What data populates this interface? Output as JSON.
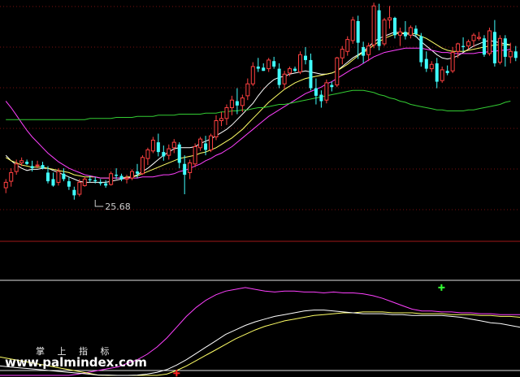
{
  "chart_data": [
    {
      "type": "candlestick",
      "title": "",
      "xlabel": "",
      "ylabel": "",
      "ylim": [
        22,
        44
      ],
      "up_color": "#ff4040",
      "down_color": "#40ffff",
      "annotations": [
        {
          "text": "25.68",
          "x": 17,
          "y": 25.68
        }
      ],
      "candles": [
        [
          26.8,
          27.6,
          26.3,
          27.3
        ],
        [
          27.4,
          28.6,
          26.9,
          28.2
        ],
        [
          28.3,
          29.4,
          28.0,
          29.0
        ],
        [
          29.1,
          29.6,
          28.8,
          29.3
        ],
        [
          29.2,
          29.4,
          28.9,
          29.0
        ],
        [
          28.8,
          29.3,
          28.3,
          28.6
        ],
        [
          28.9,
          29.3,
          28.6,
          28.9
        ],
        [
          28.9,
          29.2,
          28.5,
          28.6
        ],
        [
          28.2,
          28.8,
          27.2,
          27.4
        ],
        [
          27.6,
          28.2,
          26.9,
          27.0
        ],
        [
          27.3,
          28.6,
          27.0,
          28.3
        ],
        [
          28.1,
          28.6,
          27.4,
          27.6
        ],
        [
          27.4,
          27.8,
          26.6,
          26.9
        ],
        [
          26.6,
          26.9,
          25.7,
          26.1
        ],
        [
          26.2,
          27.6,
          26.0,
          27.3
        ],
        [
          27.0,
          27.8,
          26.9,
          27.6
        ],
        [
          27.6,
          27.9,
          27.3,
          27.5
        ],
        [
          27.5,
          27.8,
          27.2,
          27.4
        ],
        [
          27.3,
          27.6,
          27.0,
          27.2
        ],
        [
          27.2,
          27.5,
          26.8,
          27.0
        ],
        [
          27.1,
          28.3,
          27.0,
          28.1
        ],
        [
          28.0,
          28.6,
          27.6,
          27.9
        ],
        [
          27.9,
          28.1,
          27.4,
          27.6
        ],
        [
          27.6,
          28.0,
          27.2,
          27.7
        ],
        [
          27.7,
          28.5,
          27.5,
          28.3
        ],
        [
          28.3,
          29.0,
          27.7,
          28.1
        ],
        [
          28.1,
          29.8,
          28.0,
          29.6
        ],
        [
          29.5,
          30.5,
          28.9,
          30.3
        ],
        [
          30.2,
          31.5,
          30.0,
          31.2
        ],
        [
          31.0,
          31.8,
          29.7,
          30.1
        ],
        [
          30.1,
          30.7,
          29.3,
          29.7
        ],
        [
          29.8,
          30.8,
          29.4,
          30.4
        ],
        [
          30.5,
          31.3,
          30.0,
          31.0
        ],
        [
          30.8,
          31.0,
          28.6,
          29.1
        ],
        [
          29.0,
          29.8,
          26.2,
          28.0
        ],
        [
          28.2,
          29.4,
          27.6,
          29.1
        ],
        [
          29.0,
          30.9,
          28.7,
          30.6
        ],
        [
          30.5,
          31.5,
          30.2,
          31.3
        ],
        [
          30.9,
          31.6,
          29.8,
          30.3
        ],
        [
          30.3,
          31.8,
          30.1,
          31.6
        ],
        [
          31.5,
          33.5,
          31.2,
          33.0
        ],
        [
          33.0,
          33.8,
          32.5,
          33.2
        ],
        [
          33.2,
          34.5,
          32.6,
          34.2
        ],
        [
          34.2,
          35.3,
          33.5,
          34.9
        ],
        [
          34.8,
          36.0,
          33.6,
          34.4
        ],
        [
          34.4,
          35.4,
          33.8,
          35.1
        ],
        [
          35.3,
          36.9,
          34.9,
          36.4
        ],
        [
          36.4,
          38.4,
          36.2,
          38.0
        ],
        [
          38.0,
          38.8,
          37.5,
          37.8
        ],
        [
          37.9,
          38.3,
          37.6,
          37.6
        ],
        [
          37.8,
          38.8,
          37.5,
          38.6
        ],
        [
          38.5,
          38.9,
          37.8,
          38.0
        ],
        [
          37.8,
          38.3,
          36.0,
          36.3
        ],
        [
          36.4,
          37.6,
          35.9,
          37.3
        ],
        [
          37.4,
          38.0,
          37.1,
          37.8
        ],
        [
          37.8,
          38.0,
          37.5,
          37.6
        ],
        [
          37.5,
          39.4,
          37.3,
          39.1
        ],
        [
          39.0,
          39.8,
          38.2,
          38.6
        ],
        [
          38.6,
          39.2,
          35.8,
          36.0
        ],
        [
          36.0,
          36.9,
          34.5,
          35.3
        ],
        [
          35.4,
          35.8,
          34.2,
          34.8
        ],
        [
          34.9,
          36.8,
          34.6,
          36.5
        ],
        [
          36.3,
          36.6,
          35.7,
          36.1
        ],
        [
          36.3,
          38.9,
          36.1,
          38.8
        ],
        [
          38.8,
          39.9,
          38.2,
          39.6
        ],
        [
          39.4,
          40.8,
          39.0,
          40.5
        ],
        [
          40.4,
          42.6,
          40.1,
          42.3
        ],
        [
          42.2,
          42.7,
          38.7,
          40.2
        ],
        [
          39.8,
          40.3,
          38.3,
          39.0
        ],
        [
          39.1,
          40.2,
          38.5,
          39.9
        ],
        [
          40.0,
          43.9,
          39.7,
          43.6
        ],
        [
          43.2,
          43.8,
          39.5,
          39.9
        ],
        [
          40.1,
          42.5,
          39.9,
          42.3
        ],
        [
          42.3,
          43.6,
          41.5,
          42.5
        ],
        [
          42.5,
          42.6,
          40.6,
          40.9
        ],
        [
          40.9,
          41.6,
          39.9,
          41.2
        ],
        [
          41.2,
          42.2,
          40.5,
          40.8
        ],
        [
          40.9,
          41.8,
          40.6,
          41.6
        ],
        [
          41.5,
          41.8,
          40.7,
          41.0
        ],
        [
          40.8,
          41.1,
          38.0,
          38.4
        ],
        [
          38.7,
          39.4,
          37.5,
          37.8
        ],
        [
          37.8,
          38.5,
          37.5,
          38.2
        ],
        [
          38.3,
          38.8,
          36.0,
          36.6
        ],
        [
          36.7,
          38.0,
          36.5,
          37.7
        ],
        [
          37.6,
          38.1,
          37.2,
          37.4
        ],
        [
          37.6,
          39.8,
          37.4,
          39.3
        ],
        [
          39.4,
          40.2,
          38.8,
          40.1
        ],
        [
          39.9,
          40.7,
          39.4,
          39.8
        ],
        [
          39.9,
          40.5,
          39.6,
          40.3
        ],
        [
          40.4,
          41.1,
          39.8,
          40.9
        ],
        [
          40.6,
          41.2,
          40.4,
          40.7
        ],
        [
          40.6,
          40.9,
          38.9,
          39.1
        ],
        [
          39.2,
          41.6,
          39.0,
          41.3
        ],
        [
          41.2,
          42.3,
          38.0,
          38.3
        ],
        [
          38.4,
          40.9,
          38.2,
          40.6
        ],
        [
          40.6,
          40.9,
          38.0,
          38.9
        ],
        [
          38.9,
          40.2,
          38.3,
          39.4
        ],
        [
          39.4,
          39.9,
          38.5,
          38.8
        ]
      ],
      "series": [
        {
          "color": "#ffffff",
          "values": [
            29.8,
            29.3,
            28.9,
            28.6,
            28.4,
            28.5,
            28.5,
            28.6,
            28.6,
            28.4,
            28.2,
            28.0,
            27.8,
            27.6,
            27.4,
            27.3,
            27.3,
            27.3,
            27.3,
            27.3,
            27.4,
            27.5,
            27.6,
            27.7,
            27.8,
            28.0,
            28.3,
            28.6,
            29.0,
            29.4,
            29.8,
            30.1,
            30.4,
            30.5,
            30.5,
            30.5,
            30.6,
            30.9,
            31.1,
            31.3,
            31.6,
            31.9,
            32.2,
            32.6,
            33.1,
            33.6,
            34.1,
            34.6,
            35.3,
            35.9,
            36.4,
            36.8,
            37.0,
            37.1,
            37.3,
            37.4,
            37.5,
            37.6,
            37.5,
            37.4,
            37.3,
            37.3,
            37.4,
            37.6,
            38.0,
            38.4,
            38.8,
            39.1,
            39.4,
            39.8,
            40.3,
            40.6,
            40.8,
            41.0,
            41.2,
            41.1,
            41.0,
            41.0,
            40.8,
            40.3,
            39.9,
            39.5,
            39.1,
            38.8,
            38.7,
            38.8,
            39.0,
            39.3,
            39.6,
            39.9,
            40.1,
            40.3,
            40.4,
            40.3,
            40.2,
            40.1,
            40.0
          ]
        },
        {
          "color": "#ffff66",
          "values": [
            29.6,
            29.3,
            29.1,
            28.9,
            28.8,
            28.7,
            28.7,
            28.7,
            28.6,
            28.5,
            28.4,
            28.3,
            28.2,
            28.0,
            27.9,
            27.8,
            27.8,
            27.8,
            27.7,
            27.7,
            27.7,
            27.7,
            27.7,
            27.8,
            27.8,
            27.9,
            28.1,
            28.3,
            28.5,
            28.7,
            28.9,
            29.1,
            29.3,
            29.5,
            29.6,
            29.7,
            29.8,
            30.0,
            30.1,
            30.3,
            30.5,
            30.8,
            31.1,
            31.4,
            31.8,
            32.2,
            32.7,
            33.2,
            33.7,
            34.2,
            34.7,
            35.1,
            35.5,
            35.9,
            36.2,
            36.5,
            36.7,
            36.9,
            37.0,
            37.1,
            37.2,
            37.3,
            37.4,
            37.6,
            37.9,
            38.2,
            38.6,
            39.0,
            39.3,
            39.6,
            40.0,
            40.3,
            40.6,
            40.8,
            41.0,
            41.1,
            41.1,
            41.1,
            41.0,
            40.8,
            40.6,
            40.3,
            40.0,
            39.7,
            39.5,
            39.4,
            39.4,
            39.4,
            39.5,
            39.6,
            39.7,
            39.8,
            39.9,
            40.0,
            40.0,
            40.0,
            40.0
          ]
        },
        {
          "color": "#ff40ff",
          "values": [
            34.8,
            34.2,
            33.5,
            32.8,
            32.1,
            31.5,
            31.0,
            30.5,
            30.0,
            29.6,
            29.2,
            28.9,
            28.6,
            28.4,
            28.2,
            28.0,
            27.9,
            27.8,
            27.7,
            27.7,
            27.7,
            27.7,
            27.7,
            27.7,
            27.7,
            27.7,
            27.8,
            27.8,
            27.8,
            27.9,
            28.0,
            28.0,
            28.1,
            28.3,
            28.4,
            28.6,
            28.8,
            29.0,
            29.3,
            29.5,
            29.8,
            30.0,
            30.3,
            30.6,
            31.0,
            31.4,
            31.8,
            32.2,
            32.6,
            33.0,
            33.4,
            33.7,
            34.0,
            34.3,
            34.6,
            34.9,
            35.2,
            35.5,
            35.7,
            35.9,
            36.1,
            36.4,
            36.6,
            36.9,
            37.2,
            37.5,
            37.8,
            38.0,
            38.3,
            38.6,
            38.9,
            39.1,
            39.3,
            39.4,
            39.5,
            39.6,
            39.7,
            39.7,
            39.7,
            39.7,
            39.6,
            39.5,
            39.4,
            39.3,
            39.3,
            39.2,
            39.2,
            39.2,
            39.2,
            39.2,
            39.3,
            39.3,
            39.4,
            39.4,
            39.5,
            39.5,
            39.6
          ]
        },
        {
          "color": "#33cc33",
          "values": [
            33.1,
            33.1,
            33.1,
            33.1,
            33.1,
            33.1,
            33.1,
            33.1,
            33.1,
            33.1,
            33.1,
            33.1,
            33.1,
            33.1,
            33.1,
            33.1,
            33.2,
            33.2,
            33.2,
            33.2,
            33.2,
            33.3,
            33.3,
            33.3,
            33.3,
            33.4,
            33.4,
            33.4,
            33.4,
            33.5,
            33.5,
            33.5,
            33.5,
            33.6,
            33.6,
            33.6,
            33.6,
            33.6,
            33.7,
            33.7,
            33.7,
            33.8,
            33.8,
            33.9,
            33.9,
            34.0,
            34.0,
            34.1,
            34.2,
            34.2,
            34.3,
            34.4,
            34.5,
            34.5,
            34.6,
            34.7,
            34.8,
            34.9,
            35.0,
            35.1,
            35.2,
            35.3,
            35.4,
            35.5,
            35.6,
            35.7,
            35.8,
            35.8,
            35.8,
            35.7,
            35.6,
            35.4,
            35.3,
            35.1,
            35.0,
            34.8,
            34.7,
            34.5,
            34.4,
            34.3,
            34.2,
            34.1,
            34.0,
            34.0,
            33.9,
            33.9,
            33.9,
            33.9,
            34.0,
            34.0,
            34.1,
            34.2,
            34.3,
            34.4,
            34.5,
            34.7,
            34.8
          ]
        }
      ]
    },
    {
      "type": "line",
      "title": "",
      "xlabel": "",
      "ylabel": "",
      "ylim": [
        0,
        100
      ],
      "reference_lines": [
        90,
        0
      ],
      "markers": [
        {
          "x": 45,
          "y": 92,
          "color": "#33ff33"
        },
        {
          "x": 18,
          "y": -3,
          "color": "#ff2222"
        }
      ],
      "series": [
        {
          "color": "#ff40ff",
          "values": [
            -20,
            -18,
            -16,
            -14,
            -12,
            -10,
            -8,
            -6,
            -4,
            -2,
            0,
            2,
            4,
            8,
            12,
            18,
            26,
            36,
            48,
            60,
            70,
            78,
            84,
            88,
            90,
            92,
            90,
            88,
            87,
            88,
            88,
            87,
            87,
            86,
            87,
            86,
            86,
            85,
            83,
            80,
            76,
            72,
            68,
            66,
            66,
            65,
            65,
            64,
            64,
            63,
            63,
            62,
            62,
            62
          ]
        },
        {
          "color": "#ffff66",
          "values": [
            15,
            13,
            11,
            9,
            7,
            5,
            3,
            1,
            -1,
            -3,
            -5,
            -7,
            -9,
            -10,
            -10,
            -9,
            -7,
            -4,
            0,
            5,
            11,
            17,
            23,
            29,
            35,
            40,
            45,
            49,
            52,
            55,
            57,
            59,
            61,
            62,
            63,
            64,
            64,
            65,
            65,
            65,
            64,
            64,
            64,
            63,
            63,
            63,
            62,
            62,
            62,
            61,
            61,
            60,
            60,
            59
          ]
        },
        {
          "color": "#ffffff",
          "values": [
            5,
            4,
            3,
            2,
            1,
            0,
            -1,
            -2,
            -3,
            -4,
            -5,
            -5,
            -6,
            -6,
            -5,
            -4,
            -2,
            1,
            6,
            12,
            19,
            26,
            33,
            40,
            45,
            50,
            54,
            57,
            60,
            62,
            64,
            66,
            67,
            67,
            66,
            65,
            64,
            63,
            63,
            63,
            62,
            62,
            61,
            61,
            61,
            61,
            60,
            59,
            57,
            55,
            53,
            52,
            50,
            48
          ]
        }
      ]
    }
  ],
  "watermark": {
    "label": "掌 上 指 标",
    "site": "www.palmindex.com"
  }
}
